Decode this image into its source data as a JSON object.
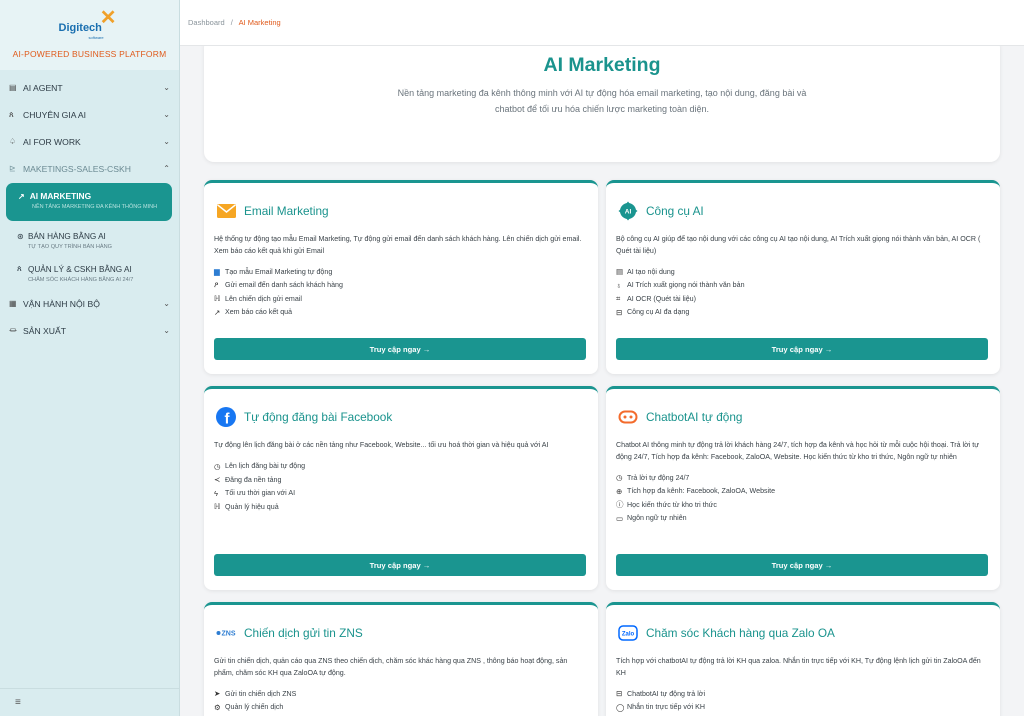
{
  "brand": {
    "logo_main": "Digitech",
    "logo_sub": "software",
    "tagline": "AI-POWERED BUSINESS PLATFORM"
  },
  "sidebar": {
    "items": [
      {
        "label": "AI AGENT",
        "icon": "robot-icon"
      },
      {
        "label": "CHUYÊN GIA AI",
        "icon": "person-icon"
      },
      {
        "label": "AI FOR WORK",
        "icon": "briefcase-icon"
      },
      {
        "label": "MAKETINGS-SALES-CSKH",
        "icon": "chart-icon"
      }
    ],
    "sub_items": [
      {
        "title": "AI MARKETING",
        "subtitle": "NỀN TẢNG MARKETING ĐA KÊNH THÔNG MINH"
      },
      {
        "title": "BÁN HÀNG BẰNG AI",
        "subtitle": "TỰ TẠO QUY TRÌNH BÁN HÀNG"
      },
      {
        "title": "QUẢN LÝ & CSKH BẰNG AI",
        "subtitle": "CHĂM SÓC KHÁCH HÀNG BẰNG AI 24/7"
      }
    ],
    "items_after": [
      {
        "label": "VẬN HÀNH NỘI BỘ",
        "icon": "grid-icon"
      },
      {
        "label": "SẢN XUẤT",
        "icon": "factory-icon"
      }
    ],
    "bottom_icon": "≡"
  },
  "breadcrumb": {
    "home": "Dashboard",
    "separator": "/",
    "current": "AI Marketing"
  },
  "hero": {
    "title": "AI Marketing",
    "description": "Nền tảng marketing đa kênh thông minh với AI tự động hóa email marketing, tạo nội dung, đăng bài và chatbot để tối ưu hóa chiến lược marketing toàn diện."
  },
  "cards": [
    {
      "title": "Email Marketing",
      "icon": "email-icon",
      "description": "Hệ thống tự động tạo mẫu Email Marketing, Tự động gửi email đến danh sách khách hàng. Lên chiến dịch gửi email. Xem báo cáo kết quả khi gửi Email",
      "features": [
        "Tạo mẫu Email Marketing tự động",
        "Gửi email đến danh sách khách hàng",
        "Lên chiến dịch gửi email",
        "Xem báo cáo kết quả"
      ],
      "button": "Truy cập ngay →"
    },
    {
      "title": "Công cụ AI",
      "icon": "ai-chip-icon",
      "description": "Bộ công cụ AI giúp để tạo nội dung với các công cụ AI tạo nội dung, AI Trích xuất giọng nói thành văn bản, AI OCR ( Quét tài liệu)",
      "features": [
        "AI tạo nội dung",
        "AI Trích xuất giọng nói thành văn bản",
        "AI OCR (Quét tài liệu)",
        "Công cụ AI đa dạng"
      ],
      "button": "Truy cập ngay →"
    },
    {
      "title": "Tự động đăng bài Facebook",
      "icon": "facebook-icon",
      "description": "Tự động lên lịch đăng bài ở các nền tảng như Facebook, Website... tối ưu hoá thời gian và hiệu quả với AI",
      "features": [
        "Lên lịch đăng bài tự động",
        "Đăng đa nền tảng",
        "Tối ưu thời gian với AI",
        "Quản lý hiệu quả"
      ],
      "button": "Truy cập ngay →"
    },
    {
      "title": "ChatbotAI tự động",
      "icon": "chatbot-icon",
      "description": "Chatbot AI thông minh tự động trả lời khách hàng 24/7, tích hợp đa kênh và học hỏi từ mỗi cuộc hội thoại. Trả lời tự động 24/7, Tích hợp đa kênh: Facebook, ZaloOA, Website. Học kiến thức từ kho tri thức, Ngôn ngữ tự nhiên",
      "features": [
        "Trả lời tự động 24/7",
        "Tích hợp đa kênh: Facebook, ZaloOA, Website",
        "Học kiến thức từ kho tri thức",
        "Ngôn ngữ tự nhiên"
      ],
      "button": "Truy cập ngay →"
    },
    {
      "title": "Chiến dịch gửi tin ZNS",
      "icon": "zns-icon",
      "icon_text": "ZNS",
      "description": "Gửi tin chiến dịch, quản cáo qua ZNS theo chiến dịch, chăm sóc khác hàng qua ZNS , thông báo hoạt động, sản phẩm, chăm sóc KH qua ZaloOA tự động.",
      "features": [
        "Gửi tin chiến dịch ZNS",
        "Quản lý chiến dịch"
      ],
      "button": ""
    },
    {
      "title": "Chăm sóc Khách hàng qua Zalo OA",
      "icon": "zalo-icon",
      "icon_text": "Zalo",
      "description": "Tích hợp với chatbotAI tự động trả lời KH qua zaloa. Nhắn tin trực tiếp với KH, Tự động lệnh lịch gửi tin ZaloOA đến KH",
      "features": [
        "ChatbotAI tự động trả lời",
        "Nhắn tin trực tiếp với KH"
      ],
      "button": ""
    }
  ]
}
